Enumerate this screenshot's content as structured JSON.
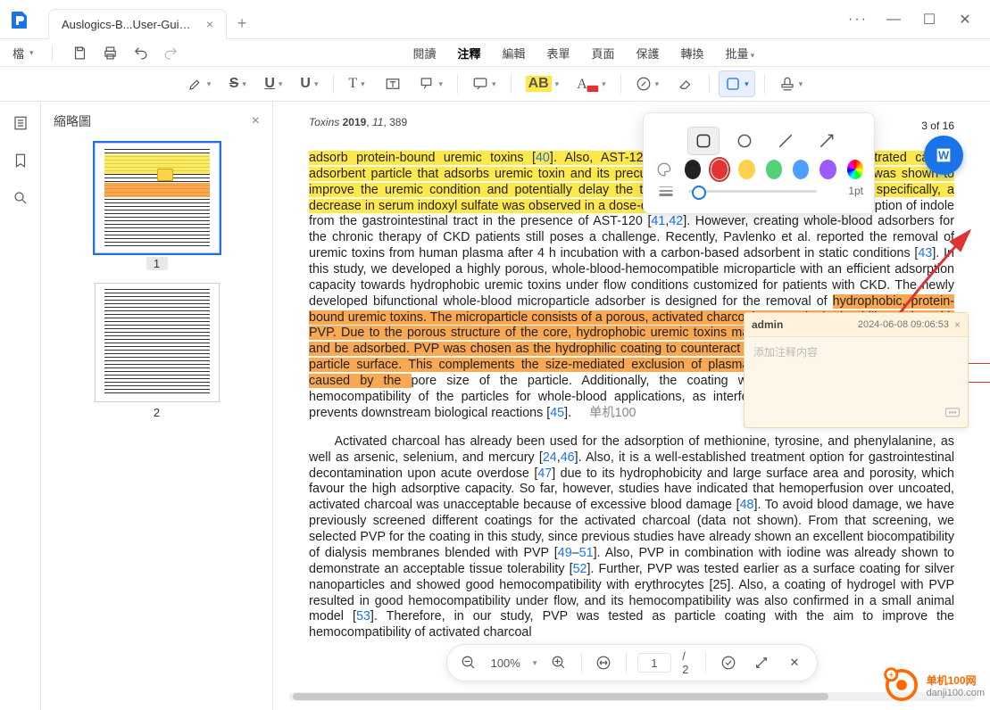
{
  "tab": {
    "title": "Auslogics-B...User-Guide*"
  },
  "menu_left": {
    "file": "檔"
  },
  "menu_center": [
    "閱讀",
    "注釋",
    "編輯",
    "表單",
    "頁面",
    "保護",
    "轉換",
    "批量"
  ],
  "menu_active_index": 1,
  "thumbs": {
    "heading": "縮略圖",
    "pages": [
      "1",
      "2"
    ]
  },
  "doc": {
    "journal": "Toxins",
    "year": "2019",
    "vol": "11",
    "art": "389",
    "page_of": "3 of 16",
    "p1_y": "adsorb protein-bound uremic toxins [",
    "c40": "40",
    "p1_y2": "]. Also, AST-120, a clinically-approved orally administrated carbon adsorbent particle that adsorbs uremic toxin and its precursor, such as indoxyl sulfate. AST-120 was shown to improve the uremic condition and potentially delay the time to initiation of hemodialysis.",
    "p1_y3": " More specifically, a decrease in serum indoxyl sulfate was observed in a dose-dependent manner by ",
    "p1_n1": "reducing the absorption of indole from the gastrointestinal tract in the presence of AST-120 [",
    "c41": "41",
    "c42": "42",
    "p1_n2": "]. However, creating whole-blood adsorbers for the chronic therapy of CKD patients still poses a challenge. Recently, Pavlenko et al. reported the removal of uremic toxins from human plasma after 4 h incubation with a carbon-based adsorbent in static conditions [",
    "c43": "43",
    "p1_n3": "]. In this study, we developed a highly porous, whole-blood-hemocompatible microparticle with an efficient adsorption capacity towards hydrophobic uremic toxins under flow conditions customized for patients with CKD. The newly developed bifunctional whole-blood microparticle adsorber is designed for the removal of ",
    "p1_o": "hydrophobic, protein-bound uremic toxins. The microparticle consists of a porous, activated charcoal core and a hydrophilic coating with PVP. Due to the porous structure of the core, hydrophobic uremic toxins may diffuse into the activated charcoal and be adsorbed. PVP was chosen as the hydrophilic coating to counteract the binding of plasma proteins to the particle surface. This complements the size-mediated exclusion of plasma proteins from the pores, which is caused by the ",
    "p1_n4": "pore size of the particle. Additionally, the coating with PVP was selected to induce hemocompatibility of the particles for whole-blood applications, as interference with protein adsorption also prevents downstream biological reactions [",
    "c45": "45",
    "wm": "单机100",
    "p2": "Activated charcoal has already been used for the adsorption of methionine, tyrosine, and phenylalanine, as well as arsenic, selenium, and mercury [",
    "c24": "24",
    "c46": "46",
    "p2b": "]. Also, it is a well-established treatment option for gastrointestinal decontamination upon acute overdose [",
    "c47": "47",
    "p2c": "] due to its hydrophobicity and large surface area and porosity, which favour the high adsorptive capacity. So far, however, studies have indicated that hemoperfusion over uncoated, activated charcoal was unacceptable because of excessive blood damage [",
    "c48": "48",
    "p2d": "]. To avoid blood damage, we have previously screened different coatings for the activated charcoal (data not shown). From that screening, we selected PVP for the coating in this study, since previous studies have already shown an excellent biocompatibility of dialysis membranes blended with PVP [",
    "c49": "49",
    "c51": "51",
    "p2e": "]. Also, PVP in combination with iodine was already shown to demonstrate an acceptable tissue tolerability [",
    "c52": "52",
    "p2f": "]. Further, PVP was tested earlier as a surface coating for silver nanoparticles and showed good hemocompatibility with erythrocytes [25]. Also, a coating of hydrogel with PVP resulted in good hemocompatibility under flow, and its hemocompatibility was also confirmed in a small animal model [",
    "c53": "53",
    "p2g": "]. Therefore, in our study, PVP was tested as particle coating with the aim to improve the hemocompatibility of activated charcoal"
  },
  "popup": {
    "pt": "1pt",
    "colors": [
      "#222222",
      "#e33434",
      "#ffd24d",
      "#53d27a",
      "#4da0ff",
      "#9a5cff",
      "#grad"
    ]
  },
  "comment": {
    "user": "admin",
    "time": "2024-06-08 09:06:53",
    "placeholder": "添加注释内容"
  },
  "floatbar": {
    "zoom": "100%",
    "page": "1",
    "total": "2"
  },
  "brand": {
    "name": "单机100网",
    "url": "danji100.com"
  }
}
